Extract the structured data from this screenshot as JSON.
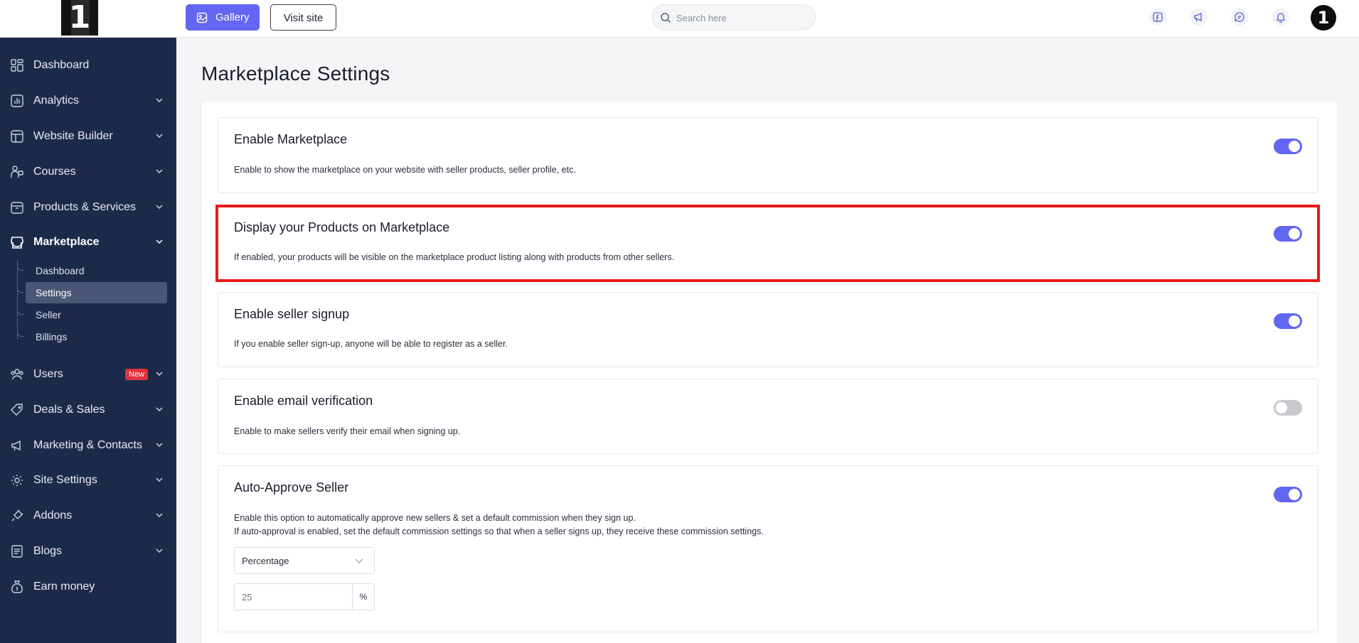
{
  "logo": {
    "text": "1"
  },
  "sidebar": {
    "items": [
      {
        "key": "dashboard",
        "label": "Dashboard",
        "icon": "grid-icon",
        "chevron": false
      },
      {
        "key": "analytics",
        "label": "Analytics",
        "icon": "bar-chart-icon",
        "chevron": true
      },
      {
        "key": "website-builder",
        "label": "Website Builder",
        "icon": "layout-icon",
        "chevron": true
      },
      {
        "key": "courses",
        "label": "Courses",
        "icon": "teacher-icon",
        "chevron": true
      },
      {
        "key": "products-services",
        "label": "Products & Services",
        "icon": "package-icon",
        "chevron": true
      },
      {
        "key": "marketplace",
        "label": "Marketplace",
        "icon": "store-icon",
        "chevron": true,
        "active": true
      },
      {
        "key": "users",
        "label": "Users",
        "icon": "users-icon",
        "chevron": true,
        "badge": "New"
      },
      {
        "key": "deals-sales",
        "label": "Deals & Sales",
        "icon": "tag-icon",
        "chevron": true
      },
      {
        "key": "marketing-contacts",
        "label": "Marketing & Contacts",
        "icon": "megaphone-icon",
        "chevron": true
      },
      {
        "key": "site-settings",
        "label": "Site Settings",
        "icon": "settings-icon",
        "chevron": true
      },
      {
        "key": "addons",
        "label": "Addons",
        "icon": "plug-icon",
        "chevron": true
      },
      {
        "key": "blogs",
        "label": "Blogs",
        "icon": "document-icon",
        "chevron": true
      },
      {
        "key": "earn-money",
        "label": "Earn money",
        "icon": "money-bag-icon",
        "chevron": false
      }
    ],
    "marketplace_sub": [
      {
        "label": "Dashboard",
        "active": false
      },
      {
        "label": "Settings",
        "active": true
      },
      {
        "label": "Seller",
        "active": false
      },
      {
        "label": "Billings",
        "active": false
      }
    ]
  },
  "topbar": {
    "gallery_label": "Gallery",
    "visit_label": "Visit site",
    "search_placeholder": "Search here",
    "icons": [
      "facebook-icon",
      "megaphone-icon",
      "chat-icon",
      "bell-icon"
    ],
    "avatar_text": "1"
  },
  "main": {
    "title": "Marketplace Settings",
    "settings": [
      {
        "key": "enable-marketplace",
        "title": "Enable Marketplace",
        "desc": [
          "Enable to show the marketplace on your website with seller products, seller profile, etc."
        ],
        "enabled": true
      },
      {
        "key": "display-products",
        "title": "Display your Products on Marketplace",
        "desc": [
          "If enabled, your products will be visible on the marketplace product listing along with products from other sellers."
        ],
        "enabled": true,
        "highlighted": true
      },
      {
        "key": "seller-signup",
        "title": "Enable seller signup",
        "desc": [
          "If you enable seller sign-up, anyone will be able to register as a seller."
        ],
        "enabled": true
      },
      {
        "key": "email-verification",
        "title": "Enable email verification",
        "desc": [
          "Enable to make sellers verify their email when signing up."
        ],
        "enabled": false
      },
      {
        "key": "auto-approve",
        "title": "Auto-Approve Seller",
        "desc": [
          "Enable this option to automatically approve new sellers & set a default commission when they sign up.",
          "If auto-approval is enabled, set the default commission settings so that when a seller signs up, they receive these commission settings."
        ],
        "enabled": true
      }
    ],
    "commission": {
      "type_value": "Percentage",
      "amount_placeholder": "25",
      "amount_value": "",
      "unit": "%"
    }
  },
  "colors": {
    "sidebar_bg": "#1c2a4a",
    "accent": "#6366f1",
    "highlight_border": "#e81919",
    "badge_bg": "#e0323b"
  }
}
